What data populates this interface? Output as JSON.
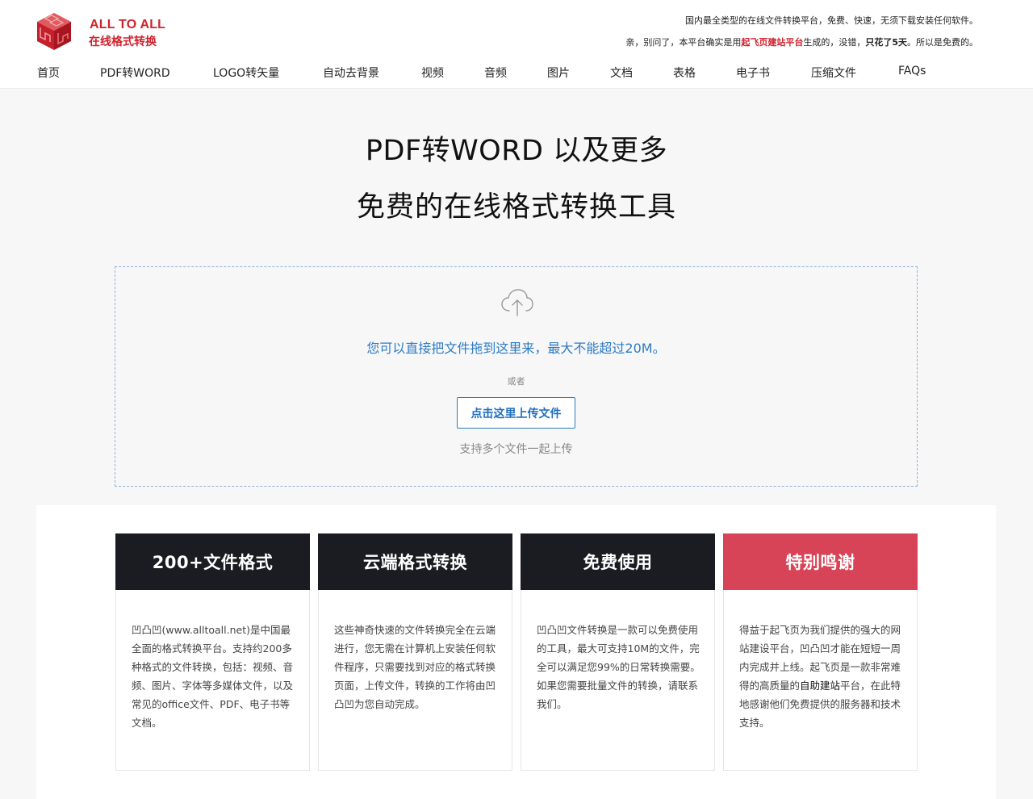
{
  "header": {
    "logo_line1": "ALL TO ALL",
    "logo_line2": "在线格式转换",
    "notice_1": "国内最全类型的在线文件转换平台，免费、快速，无须下载安装任何软件。",
    "notice_2_pre": "亲，别问了，本平台确实是用",
    "notice_2_link": "起飞页建站平台",
    "notice_2_mid": "生成的，没错，",
    "notice_2_strong": "只花了5天",
    "notice_2_post": "。所以是免费的。"
  },
  "nav": [
    "首页",
    "PDF转WORD",
    "LOGO转矢量",
    "自动去背景",
    "视频",
    "音频",
    "图片",
    "文档",
    "表格",
    "电子书",
    "压缩文件",
    "FAQs"
  ],
  "hero": {
    "title_1": "PDF转WORD 以及更多",
    "title_2": "免费的在线格式转换工具"
  },
  "upload": {
    "icon": "cloud-upload-icon",
    "drag_text": "您可以直接把文件拖到这里来，最大不能超过20M。",
    "or_text": "或者",
    "button_label": "点击这里上传文件",
    "multi_text": "支持多个文件一起上传"
  },
  "features": [
    {
      "title": "200+文件格式",
      "body": "凹凸凹(www.alltoall.net)是中国最全面的格式转换平台。支持约200多种格式的文件转换，包括：视频、音频、图片、字体等多媒体文件，以及常见的office文件、PDF、电子书等文档。"
    },
    {
      "title": "云端格式转换",
      "body": "这些神奇快速的文件转换完全在云端进行，您无需在计算机上安装任何软件程序，只需要找到对应的格式转换页面，上传文件，转换的工作将由凹凸凹为您自动完成。"
    },
    {
      "title": "免费使用",
      "body": "凹凸凹文件转换是一款可以免费使用的工具，最大可支持10M的文件，完全可以满足您99%的日常转换需要。如果您需要批量文件的转换，请联系我们。"
    },
    {
      "title": "特别鸣谢",
      "body_pre": "得益于起飞页为我们提供的强大的网站建设平台，凹凸凹才能在短短一周内完成并上线。起飞页是一款非常难得的高质量的",
      "body_strong": "自助建站",
      "body_post": "平台，在此特地感谢他们免费提供的服务器和技术支持。"
    }
  ],
  "colors": {
    "brand_red": "#d0222d",
    "link_blue": "#2d7bc3",
    "card_dark": "#1b1c21",
    "card_red": "#d84457"
  }
}
